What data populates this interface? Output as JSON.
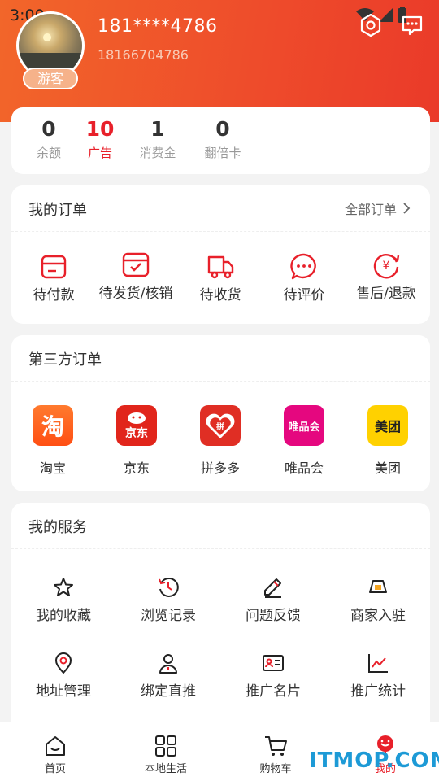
{
  "status_bar": {
    "time": "3:00"
  },
  "profile": {
    "phone_masked": "181****4786",
    "phone_full": "18166704786",
    "badge": "游客"
  },
  "stats": [
    {
      "value": "0",
      "label": "余额"
    },
    {
      "value": "10",
      "label": "广告"
    },
    {
      "value": "1",
      "label": "消费金"
    },
    {
      "value": "0",
      "label": "翻倍卡"
    }
  ],
  "orders": {
    "title": "我的订单",
    "all_label": "全部订单",
    "items": [
      {
        "label": "待付款",
        "icon": "wallet-icon"
      },
      {
        "label": "待发货/核销",
        "icon": "calendar-check-icon"
      },
      {
        "label": "待收货",
        "icon": "truck-icon"
      },
      {
        "label": "待评价",
        "icon": "comment-icon"
      },
      {
        "label": "售后/退款",
        "icon": "yen-refresh-icon"
      }
    ]
  },
  "third_party": {
    "title": "第三方订单",
    "shops": [
      {
        "label": "淘宝",
        "logo_text": "淘",
        "color": "#ff5a1f"
      },
      {
        "label": "京东",
        "logo_text": "京东",
        "color": "#e1251b"
      },
      {
        "label": "拼多多",
        "logo_text": "拼",
        "color": "#e02e24"
      },
      {
        "label": "唯品会",
        "logo_text": "唯品会",
        "color": "#e5077f"
      },
      {
        "label": "美团",
        "logo_text": "美团",
        "color": "#ffd100"
      }
    ]
  },
  "services": {
    "title": "我的服务",
    "items": [
      {
        "label": "我的收藏",
        "icon": "star-icon"
      },
      {
        "label": "浏览记录",
        "icon": "history-icon"
      },
      {
        "label": "问题反馈",
        "icon": "pen-icon"
      },
      {
        "label": "商家入驻",
        "icon": "shop-icon"
      },
      {
        "label": "地址管理",
        "icon": "location-icon"
      },
      {
        "label": "绑定直推",
        "icon": "user-icon"
      },
      {
        "label": "推广名片",
        "icon": "id-card-icon"
      },
      {
        "label": "推广统计",
        "icon": "line-chart-icon"
      }
    ]
  },
  "tabbar": [
    {
      "label": "首页",
      "icon": "home-icon"
    },
    {
      "label": "本地生活",
      "icon": "grid-icon"
    },
    {
      "label": "购物车",
      "icon": "cart-icon"
    },
    {
      "label": "我的",
      "icon": "profile-icon"
    }
  ],
  "watermark": "ITMOP.COM",
  "colors": {
    "accent": "#ee4b2b",
    "highlight": "#e8202a"
  }
}
